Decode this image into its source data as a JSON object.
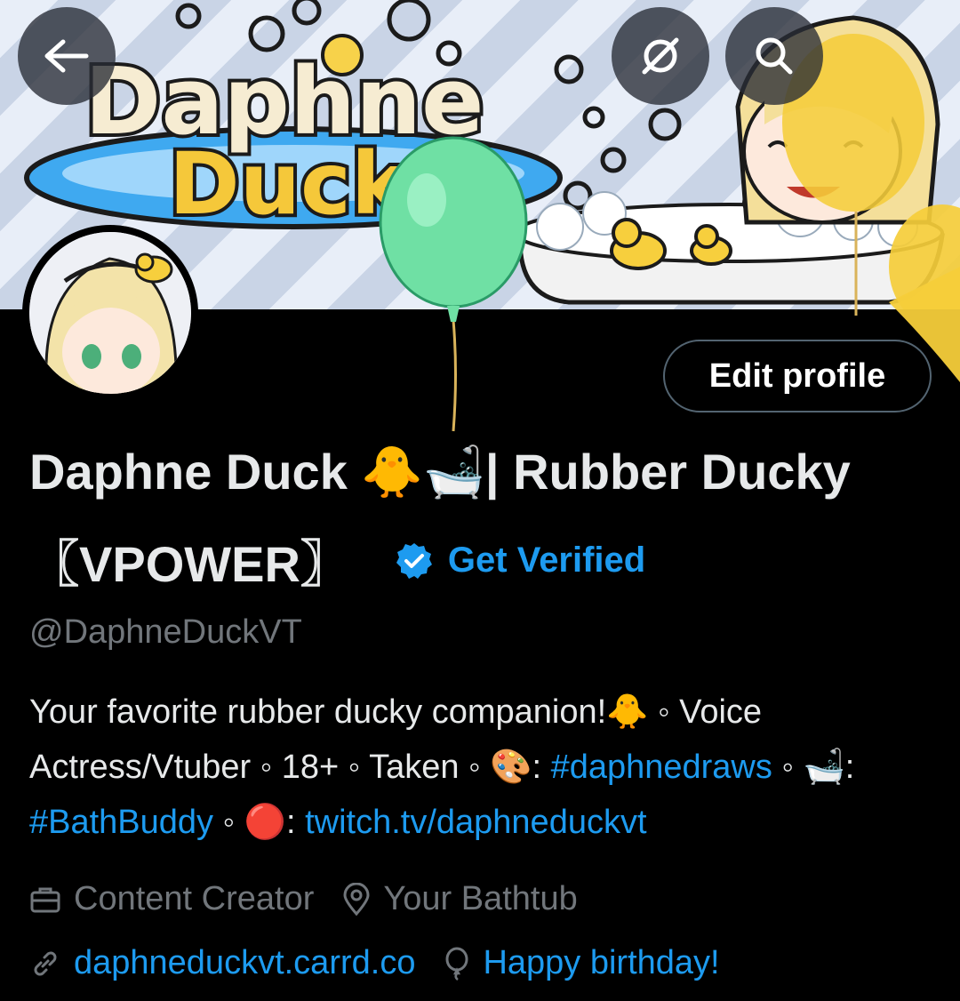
{
  "header": {
    "back_icon": "arrow-left-icon",
    "overflow_icon": "eye-slash-icon",
    "search_icon": "search-icon",
    "banner_logo": "Daphne Duck"
  },
  "profile": {
    "edit_label": "Edit profile",
    "name_part1": "Daphne Duck 🐥🛁| Rubber Ducky",
    "name_part2": "〖VPOWER〗",
    "verified_label": "Get Verified",
    "handle": "@DaphneDuckVT",
    "bio": {
      "t1": "Your favorite rubber ducky companion!🐥 ◦ Voice Actress/Vtuber ◦ 18+ ◦ Taken ◦ 🎨: ",
      "l1": "#daphnedraws",
      "t2": " ◦ 🛁: ",
      "l2": "#BathBuddy",
      "t3": " ◦ 🔴: ",
      "l3": "twitch.tv/daphneduckvt"
    },
    "category": "Content Creator",
    "location": "Your Bathtub",
    "website": "daphneduckvt.carrd.co",
    "birthday": "Happy birthday!"
  },
  "colors": {
    "accent": "#1d9bf0",
    "muted": "#71767b",
    "text": "#e7e9ea",
    "balloon_green": "#6fe0a4",
    "balloon_yellow": "#f5cd3a"
  }
}
